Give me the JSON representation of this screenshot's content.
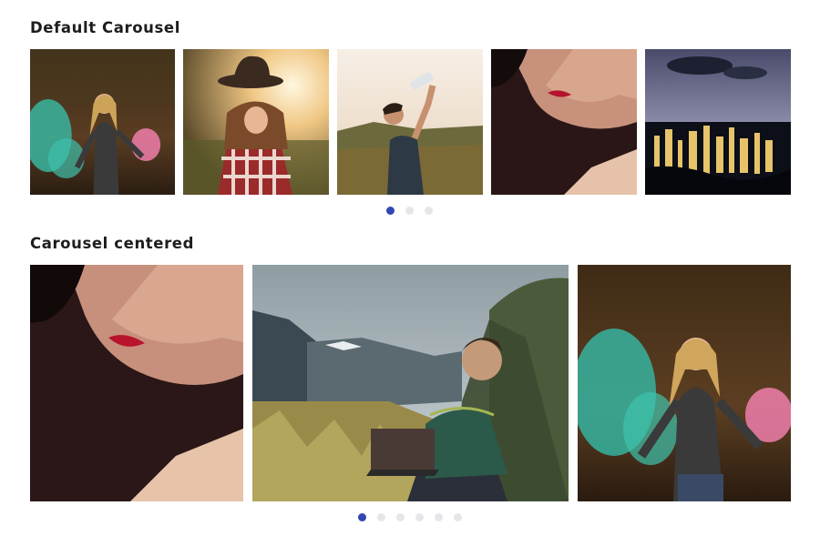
{
  "sections": {
    "default": {
      "title": "Default Carousel",
      "dots_total": 3,
      "active_dot": 1
    },
    "centered": {
      "title": "Carousel centered",
      "dots_total": 6,
      "active_dot": 1
    }
  },
  "colors": {
    "accent": "#3346b3",
    "dot_inactive": "#e6e6ea"
  }
}
